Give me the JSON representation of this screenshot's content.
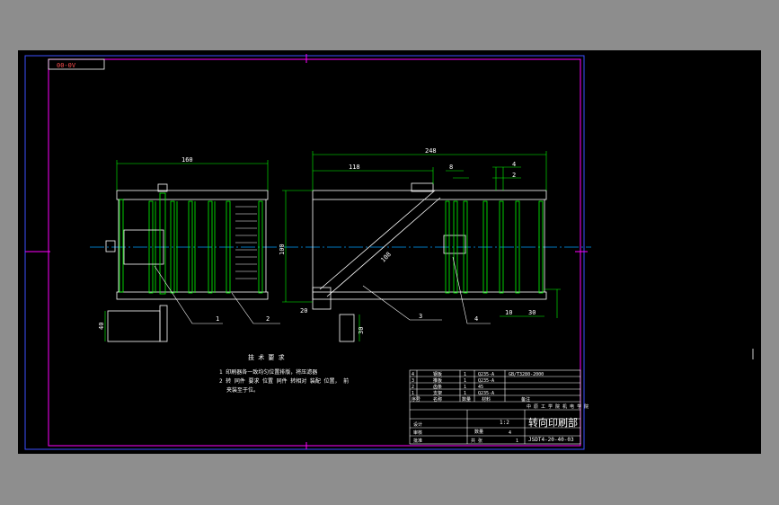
{
  "drawing": {
    "corner_label": "00-0V",
    "tech_heading": "技 术 要 求",
    "tech_line1": "1  印刷器各一致均匀位置排版，将压滤器",
    "tech_line2": "2 转 同件 要求 位置 同件 转相对 装配 位置，  前",
    "tech_line3": "  夹装至于位。",
    "dims": {
      "d160": "160",
      "d248": "248",
      "d118": "118",
      "d8": "8",
      "d4": "4",
      "d2": "2",
      "d100": "100",
      "d10": "10",
      "d30": "30",
      "d40": "40",
      "d108": "108",
      "d20": "20",
      "d30b": "30"
    },
    "callouts": [
      "1",
      "2",
      "3",
      "4"
    ]
  },
  "title_block": {
    "rows": [
      {
        "no": "4",
        "name": "钢板",
        "qty": "1",
        "mat": "Q235-A",
        "note": "GB/T3280-2000"
      },
      {
        "no": "3",
        "name": "推板",
        "qty": "1",
        "mat": "Q235-A",
        "note": ""
      },
      {
        "no": "2",
        "name": "齿条",
        "qty": "1",
        "mat": "45",
        "note": ""
      },
      {
        "no": "1",
        "name": "支架",
        "qty": "1",
        "mat": "Q235-A",
        "note": ""
      }
    ],
    "header": {
      "no": "序号",
      "name": "名称",
      "qty": "数量",
      "mat": "材料",
      "note": "备注"
    },
    "school": "中 原 工 学 院 机 电 学 院",
    "title": "转向印刷部",
    "code": "JSDT4-20-40-03",
    "scale": "1:2",
    "sheet": "共 张",
    "drawn": "设计",
    "checked": "审核",
    "approved": "批准",
    "qty_label": "数量",
    "stage_a": "4",
    "stage_b": "1"
  }
}
